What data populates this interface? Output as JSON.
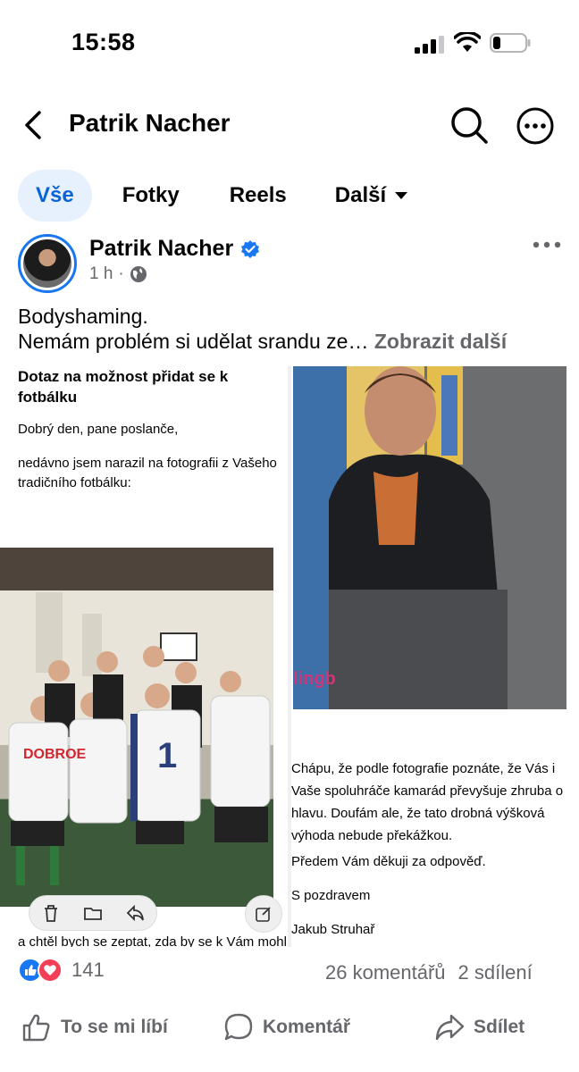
{
  "status_bar": {
    "time": "15:58"
  },
  "header": {
    "title": "Patrik Nacher"
  },
  "tabs": [
    {
      "label": "Vše",
      "active": true
    },
    {
      "label": "Fotky"
    },
    {
      "label": "Reels"
    },
    {
      "label": "Další"
    }
  ],
  "post": {
    "author": "Patrik Nacher",
    "time": "1 h",
    "separator": "·",
    "text_line1": "Bodyshaming.",
    "text_line2": "Nemám problém si udělat srandu ze…",
    "see_more": "Zobrazit další",
    "left_image": {
      "title": "Dotaz na možnost přidat se k fotbálku",
      "p1": "Dobrý den, pane poslanče,",
      "p2": "nedávno jsem narazil na fotografii z Vašeho tradičního fotbálku:",
      "last_line": "a chtěl bych se zeptat, zda by se k Vám mohl"
    },
    "right_image": {
      "paragraph": "Chápu, že podle fotografie poznáte, že Vás i Vaše spoluhráče kamarád převyšuje zhruba o hlavu. Doufám ale, že tato drobná výšková výhoda nebude překážkou.",
      "thanks": "Předem Vám děkuji za odpověď.",
      "greeting": "S pozdravem",
      "signature": "Jakub Struhař"
    },
    "reactions_count": "141",
    "comments": "26 komentářů",
    "shares": "2 sdílení"
  },
  "actions": {
    "like": "To se mi líbí",
    "comment": "Komentář",
    "share": "Sdílet"
  },
  "colors": {
    "brand_blue": "#1877f2",
    "love_red": "#f33e58",
    "muted": "#65676b"
  }
}
